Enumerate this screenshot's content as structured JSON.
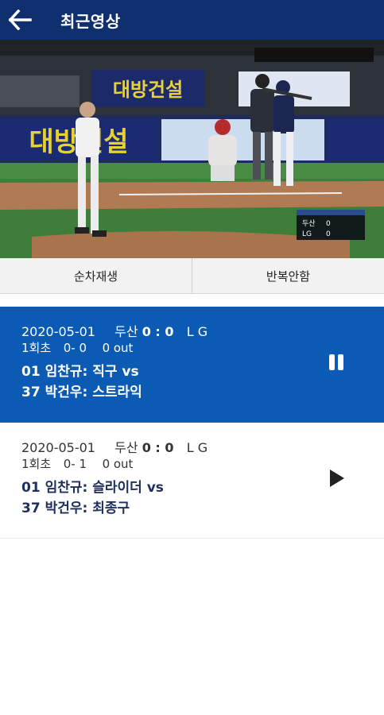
{
  "appbar": {
    "title": "최근영상",
    "back_icon": "arrow-left-icon"
  },
  "video": {
    "banner_left": "대방건설",
    "banner_top": "대방건설",
    "board_home": "두산",
    "board_away": "LG",
    "board_home_score": "0",
    "board_away_score": "0"
  },
  "controls": {
    "sequential": "순차재생",
    "repeat": "반복안함"
  },
  "clips": [
    {
      "state": "playing",
      "date": "2020-05-01",
      "home": "두산",
      "score": "0 : 0",
      "away": "L G",
      "inning": "1회초",
      "count": "0- 0",
      "outs": "0 out",
      "pitcher": "01 임찬규: 직구 vs",
      "batter": "37 박건우: 스트라익",
      "icon": "pause-icon"
    },
    {
      "state": "idle",
      "date": "2020-05-01",
      "home": "두산",
      "score": "0 : 0",
      "away": "L G",
      "inning": "1회초",
      "count": "0- 1",
      "outs": "0 out",
      "pitcher": "01 임찬규: 슬라이더 vs",
      "batter": "37 박건우: 최종구",
      "icon": "play-icon"
    }
  ],
  "colors": {
    "appbar": "#0f2f6e",
    "active_card": "#0b5bb5"
  }
}
